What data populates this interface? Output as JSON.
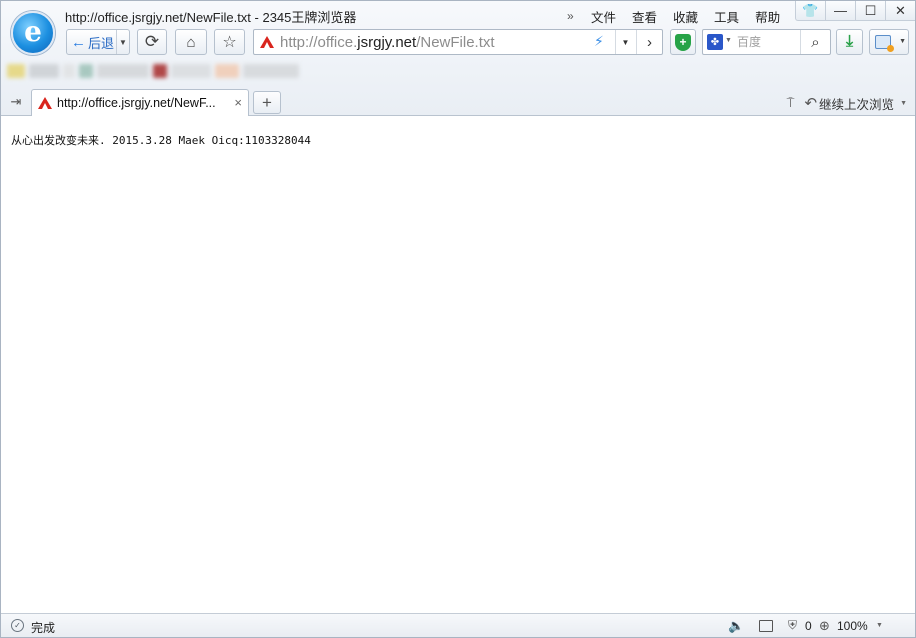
{
  "window": {
    "title": "http://office.jsrgjy.net/NewFile.txt - 2345王牌浏览器",
    "menu": {
      "more": "»",
      "items": [
        "文件",
        "查看",
        "收藏",
        "工具",
        "帮助"
      ]
    },
    "controls": {
      "skin": "👕",
      "minimize": "—",
      "maximize": "☐",
      "close": "✕"
    }
  },
  "toolbar": {
    "back_label": "后退",
    "address_prefix": "http://office.",
    "address_domain": "jsrgjy.net",
    "address_path": "/NewFile.txt",
    "search_engine_icon": "paw-icon",
    "search_placeholder": "百度"
  },
  "tabs": [
    {
      "title": "http://office.jsrgjy.net/NewF...",
      "active": true
    }
  ],
  "tab_row": {
    "resume_label": "继续上次浏览"
  },
  "content": {
    "text": "从心出发改变未来. 2015.3.28 Maek Oicq:1103328044"
  },
  "statusbar": {
    "status_text": "完成",
    "security_count": "0",
    "zoom": "100%"
  },
  "colors": {
    "accent_blue": "#2a7de1",
    "shield_green": "#27a347",
    "download_green": "#2aa14a"
  }
}
